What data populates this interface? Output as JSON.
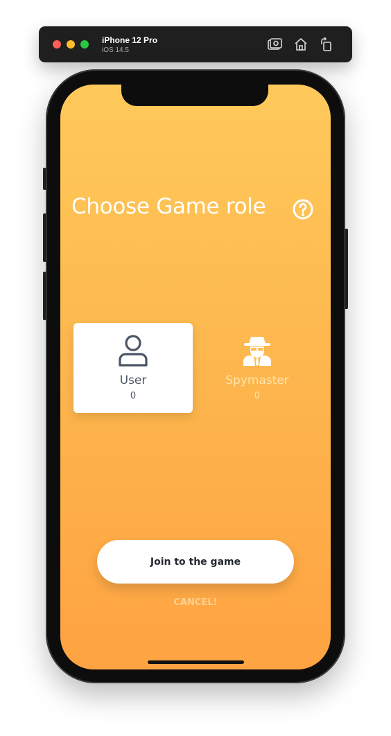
{
  "simulator": {
    "device_name": "iPhone 12 Pro",
    "os_version": "iOS 14.5",
    "buttons": [
      {
        "icon": "screenshot-icon"
      },
      {
        "icon": "home-icon"
      },
      {
        "icon": "rotate-icon"
      }
    ]
  },
  "screen": {
    "title": "Choose Game role",
    "help_icon": "question-circle-icon",
    "roles": [
      {
        "label": "User",
        "count": "0",
        "icon": "user-icon",
        "selected": true
      },
      {
        "label": "Spymaster",
        "count": "0",
        "icon": "spy-icon",
        "selected": false
      }
    ],
    "join_button": "Join to the game",
    "cancel_link": "CANCEL!"
  },
  "colors": {
    "gradient_top": "#fec95a",
    "gradient_bottom": "#fea342",
    "text_dark": "#4a5565",
    "white": "#ffffff"
  }
}
